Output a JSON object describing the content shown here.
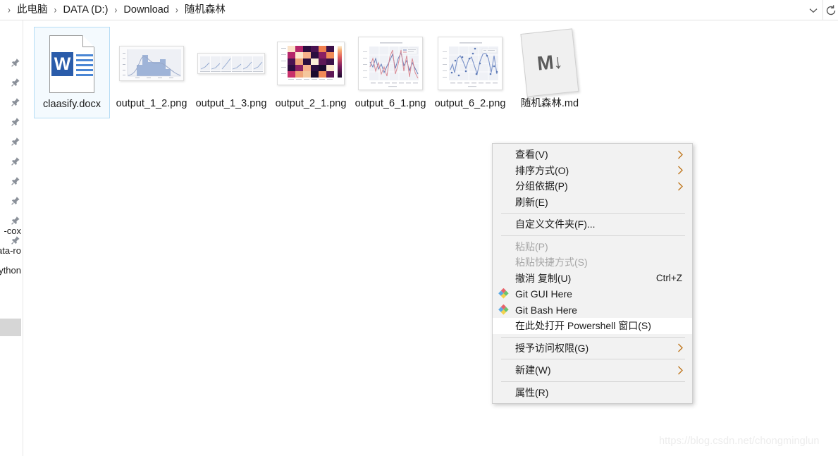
{
  "window": {
    "title": "随机森林",
    "breadcrumb": {
      "name": "address-breadcrumb",
      "lead_separator": "›",
      "separator": "›",
      "items": [
        {
          "label": "此电脑"
        },
        {
          "label": "DATA (D:)"
        },
        {
          "label": "Download"
        },
        {
          "label": "随机森林"
        }
      ]
    },
    "address_dropdown_icon": "chevron-down-icon",
    "refresh_icon": "refresh-icon"
  },
  "nav_pane": {
    "pin_icon": "pin-icon",
    "pin_count": 10,
    "clipped_items": [
      {
        "label": "-cox"
      },
      {
        "label": "ata-ro"
      },
      {
        "label": "ython"
      }
    ]
  },
  "files": [
    {
      "name": "claasify.docx",
      "icon": "word-document-icon",
      "icon_letter": "W",
      "selected": true
    },
    {
      "name": "output_1_2.png",
      "icon": "histogram-thumbnail",
      "selected": false
    },
    {
      "name": "output_1_3.png",
      "icon": "multipanel-plot-thumbnail",
      "selected": false
    },
    {
      "name": "output_2_1.png",
      "icon": "heatmap-thumbnail",
      "selected": false
    },
    {
      "name": "output_6_1.png",
      "icon": "line-chart-thumbnail",
      "selected": false
    },
    {
      "name": "output_6_2.png",
      "icon": "scatter-line-chart-thumbnail",
      "selected": false
    },
    {
      "name": "随机森林.md",
      "icon": "markdown-file-icon",
      "icon_glyph": "M↓",
      "selected": false
    }
  ],
  "context_menu": {
    "items": [
      {
        "type": "item",
        "label": "查看(V)",
        "submenu": true,
        "disabled": false,
        "icon": null,
        "accel": null,
        "highlight": false
      },
      {
        "type": "item",
        "label": "排序方式(O)",
        "submenu": true,
        "disabled": false,
        "icon": null,
        "accel": null,
        "highlight": false
      },
      {
        "type": "item",
        "label": "分组依据(P)",
        "submenu": true,
        "disabled": false,
        "icon": null,
        "accel": null,
        "highlight": false
      },
      {
        "type": "item",
        "label": "刷新(E)",
        "submenu": false,
        "disabled": false,
        "icon": null,
        "accel": null,
        "highlight": false
      },
      {
        "type": "separator"
      },
      {
        "type": "item",
        "label": "自定义文件夹(F)...",
        "submenu": false,
        "disabled": false,
        "icon": null,
        "accel": null,
        "highlight": false
      },
      {
        "type": "separator"
      },
      {
        "type": "item",
        "label": "粘贴(P)",
        "submenu": false,
        "disabled": true,
        "icon": null,
        "accel": null,
        "highlight": false
      },
      {
        "type": "item",
        "label": "粘贴快捷方式(S)",
        "submenu": false,
        "disabled": true,
        "icon": null,
        "accel": null,
        "highlight": false
      },
      {
        "type": "item",
        "label": "撤消 复制(U)",
        "submenu": false,
        "disabled": false,
        "icon": null,
        "accel": "Ctrl+Z",
        "highlight": false
      },
      {
        "type": "item",
        "label": "Git GUI Here",
        "submenu": false,
        "disabled": false,
        "icon": "git-icon",
        "accel": null,
        "highlight": false
      },
      {
        "type": "item",
        "label": "Git Bash Here",
        "submenu": false,
        "disabled": false,
        "icon": "git-icon",
        "accel": null,
        "highlight": false
      },
      {
        "type": "item",
        "label": "在此处打开 Powershell 窗口(S)",
        "submenu": false,
        "disabled": false,
        "icon": null,
        "accel": null,
        "highlight": true
      },
      {
        "type": "separator"
      },
      {
        "type": "item",
        "label": "授予访问权限(G)",
        "submenu": true,
        "disabled": false,
        "icon": null,
        "accel": null,
        "highlight": false
      },
      {
        "type": "separator"
      },
      {
        "type": "item",
        "label": "新建(W)",
        "submenu": true,
        "disabled": false,
        "icon": null,
        "accel": null,
        "highlight": false
      },
      {
        "type": "separator"
      },
      {
        "type": "item",
        "label": "属性(R)",
        "submenu": false,
        "disabled": false,
        "icon": null,
        "accel": null,
        "highlight": false
      }
    ]
  },
  "watermark": {
    "text": "https://blog.csdn.net/chongminglun"
  },
  "colors": {
    "menu_background": "#f2f2f2",
    "menu_highlight": "#ffffff",
    "selection_border": "#b5dcf5",
    "selection_fill": "#f4fafe",
    "word_blue": "#2a5caa",
    "disabled_text": "#a6a6a6",
    "watermark": "#ececec"
  }
}
